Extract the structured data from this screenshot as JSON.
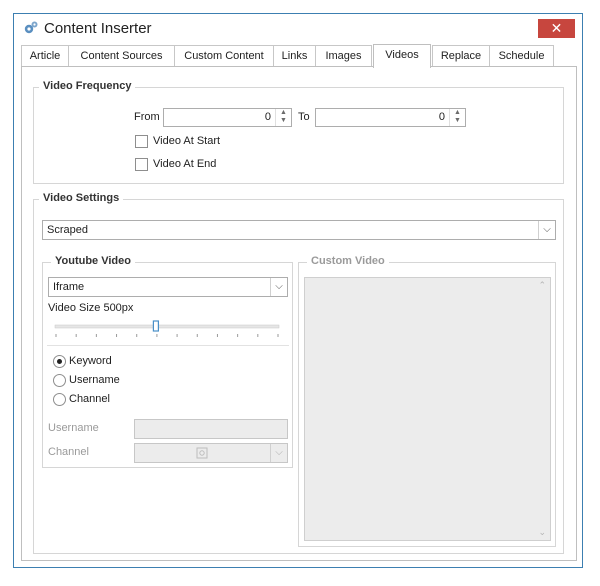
{
  "window": {
    "title": "Content Inserter",
    "close_glyph": "✕"
  },
  "tabs": [
    {
      "label": "Article"
    },
    {
      "label": "Content Sources"
    },
    {
      "label": "Custom Content"
    },
    {
      "label": "Links"
    },
    {
      "label": "Images"
    },
    {
      "label": "Videos"
    },
    {
      "label": "Replace"
    },
    {
      "label": "Schedule"
    }
  ],
  "active_tab": "Videos",
  "video_frequency": {
    "title": "Video Frequency",
    "from_label": "From",
    "from_value": "0",
    "to_label": "To",
    "to_value": "0",
    "video_at_start": {
      "label": "Video At Start",
      "checked": false
    },
    "video_at_end": {
      "label": "Video At End",
      "checked": false
    }
  },
  "video_settings": {
    "title": "Video Settings",
    "source_value": "Scraped",
    "youtube": {
      "title": "Youtube Video",
      "embed_value": "Iframe",
      "size_label": "Video Size 500px",
      "size_fraction": 0.45,
      "search_options": [
        {
          "label": "Keyword",
          "selected": true
        },
        {
          "label": "Username",
          "selected": false
        },
        {
          "label": "Channel",
          "selected": false
        }
      ],
      "username_label": "Username",
      "username_value": "",
      "channel_label": "Channel",
      "channel_value": ""
    },
    "custom": {
      "title": "Custom Video"
    }
  },
  "icons": {
    "app": "gears-icon",
    "spin": "spin-arrows-icon",
    "dropdown": "chevron-down-icon",
    "scroll_up": "scroll-up-icon",
    "scroll_down": "scroll-down-icon"
  },
  "colors": {
    "border": "#3c7fb1",
    "close": "#c7463e",
    "slider": "#4a90c8"
  }
}
